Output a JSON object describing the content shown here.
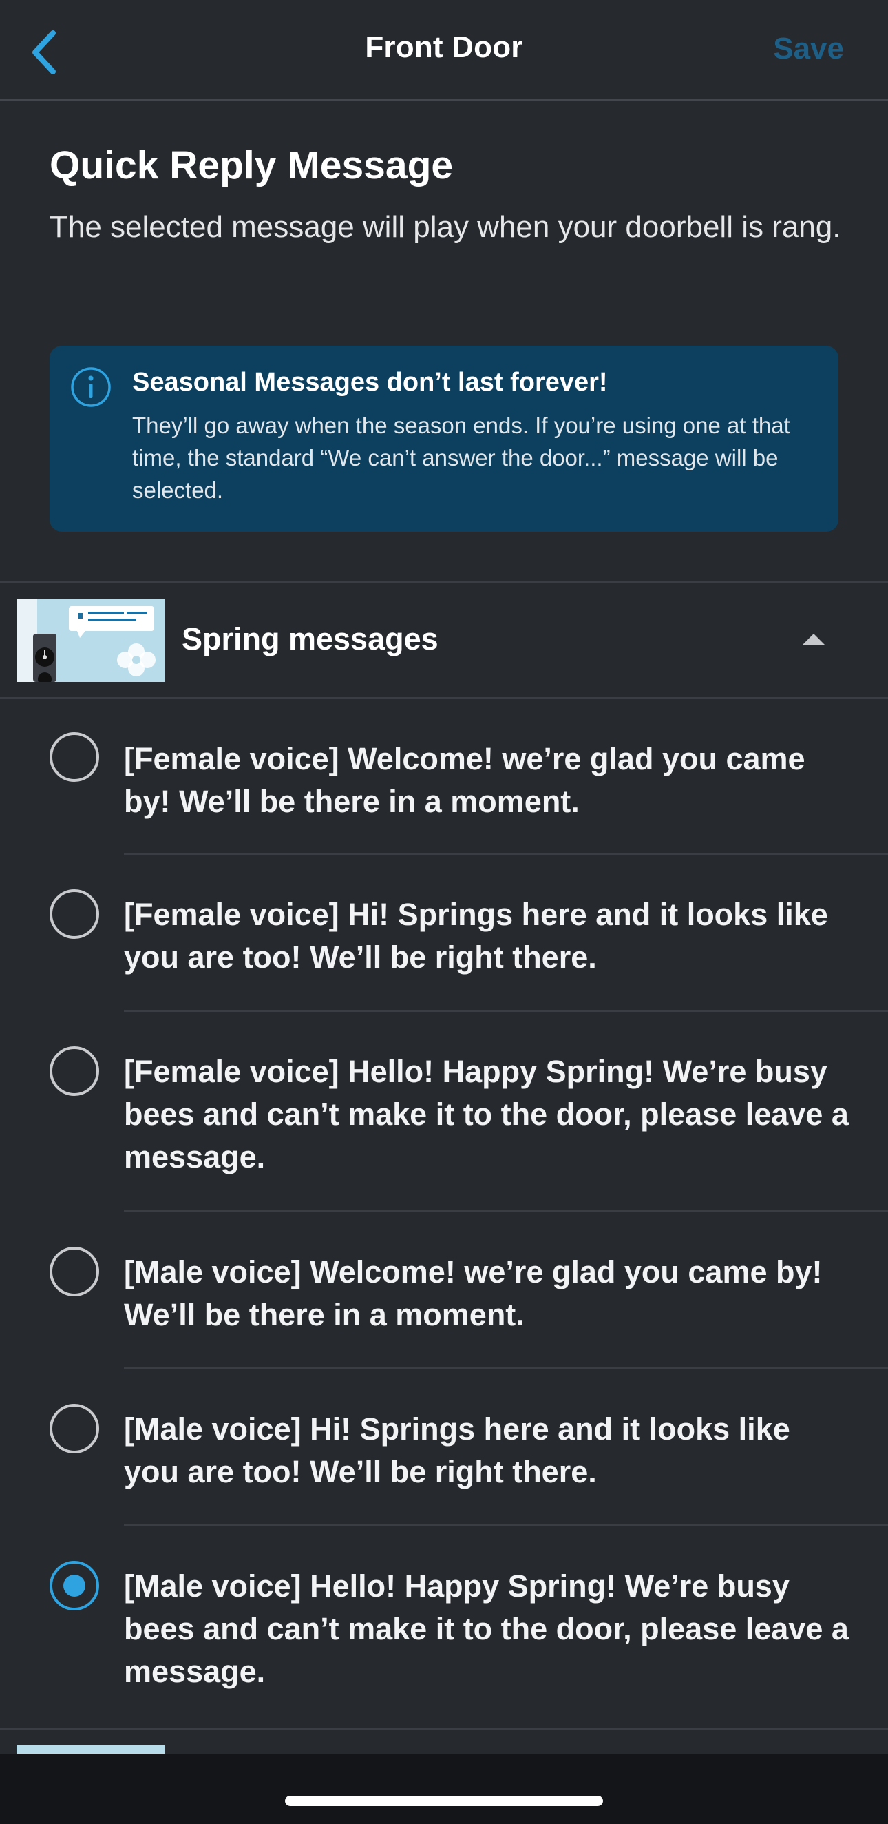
{
  "header": {
    "title": "Front Door",
    "save_label": "Save",
    "back_icon": "chevron-left-icon"
  },
  "intro": {
    "title": "Quick Reply Message",
    "description": "The selected message will play when your doorbell is rang."
  },
  "banner": {
    "title": "Seasonal Messages don’t last forever!",
    "body": "They’ll go away when the season ends. If you’re using one at that time, the standard “We can’t answer the door...” message will be selected.",
    "icon": "info-icon"
  },
  "section": {
    "label": "Spring messages",
    "expanded": true
  },
  "options": [
    {
      "text": "[Female voice] Welcome! we’re glad you came by! We’ll be there in a moment.",
      "selected": false
    },
    {
      "text": "[Female voice] Hi! Springs here and it looks like you are too! We’ll be right there.",
      "selected": false
    },
    {
      "text": "[Female voice] Hello! Happy Spring! We’re busy bees and can’t make it to the door, please leave a message.",
      "selected": false
    },
    {
      "text": "[Male voice] Welcome! we’re glad you came by! We’ll be there in a moment.",
      "selected": false
    },
    {
      "text": "[Male voice] Hi! Springs here and it looks like you are too! We’ll be right there.",
      "selected": false
    },
    {
      "text": "[Male voice] Hello! Happy Spring! We’re busy bees and can’t make it to the door, please leave a message.",
      "selected": true
    }
  ],
  "colors": {
    "background": "#26292e",
    "accent": "#2fa2e0",
    "banner": "#0d405f",
    "save_disabled": "#1e5f87"
  }
}
